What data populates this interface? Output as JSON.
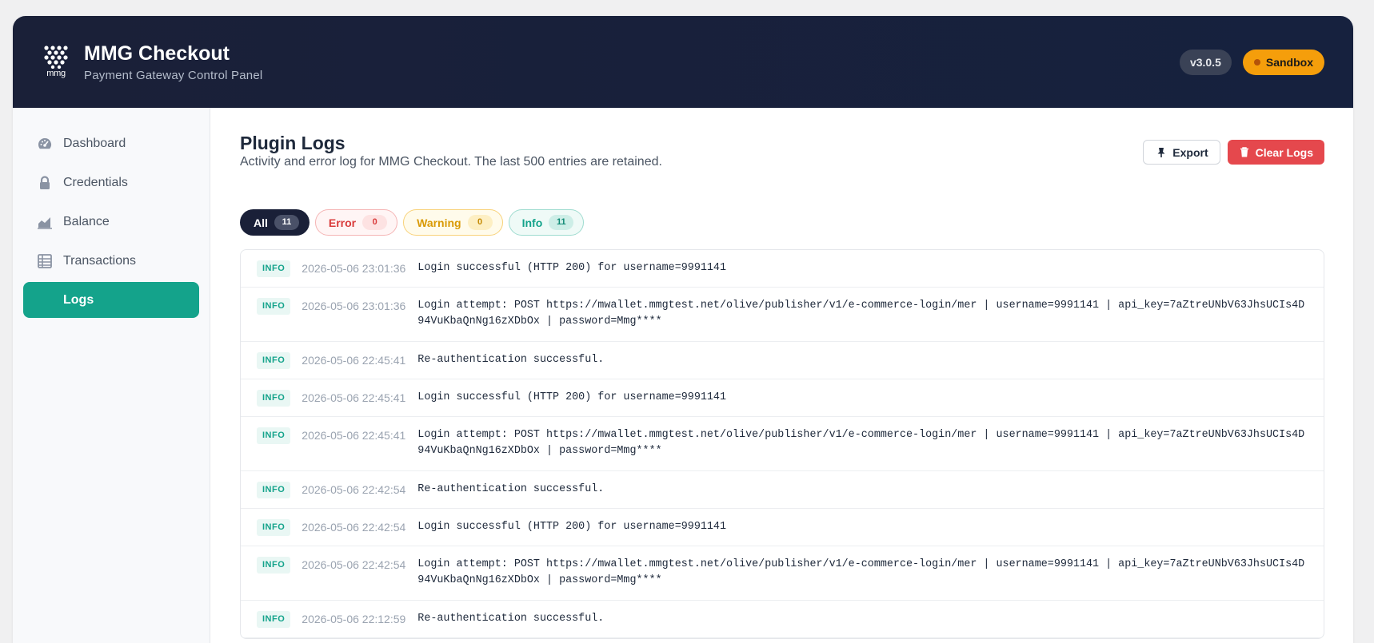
{
  "header": {
    "logo_text": "mmg",
    "title": "MMG Checkout",
    "subtitle": "Payment Gateway Control Panel",
    "version": "v3.0.5",
    "environment": "Sandbox"
  },
  "colors": {
    "header_bg": "#1a2038",
    "accent": "#14a38b",
    "danger": "#e5484d",
    "warning": "#f59e0b"
  },
  "sidebar": {
    "items": [
      {
        "label": "Dashboard",
        "icon": "gauge-icon",
        "active": false
      },
      {
        "label": "Credentials",
        "icon": "lock-icon",
        "active": false
      },
      {
        "label": "Balance",
        "icon": "chart-icon",
        "active": false
      },
      {
        "label": "Transactions",
        "icon": "list-icon",
        "active": false
      },
      {
        "label": "Logs",
        "icon": "",
        "active": true
      }
    ]
  },
  "main": {
    "title": "Plugin Logs",
    "description": "Activity and error log for MMG Checkout. The last 500 entries are retained.",
    "export_label": "Export",
    "clear_label": "Clear Logs",
    "filters": [
      {
        "label": "All",
        "count": "11"
      },
      {
        "label": "Error",
        "count": "0"
      },
      {
        "label": "Warning",
        "count": "0"
      },
      {
        "label": "Info",
        "count": "11"
      }
    ],
    "logs": [
      {
        "level": "INFO",
        "time": "2026-05-06 23:01:36",
        "message": "Login successful (HTTP 200) for username=9991141"
      },
      {
        "level": "INFO",
        "time": "2026-05-06 23:01:36",
        "message": "Login attempt: POST https://mwallet.mmgtest.net/olive/publisher/v1/e-commerce-login/mer | username=9991141 | api_key=7aZtreUNbV63JhsUCIs4D94VuKbaQnNg16zXDbOx | password=Mmg****"
      },
      {
        "level": "INFO",
        "time": "2026-05-06 22:45:41",
        "message": "Re-authentication successful."
      },
      {
        "level": "INFO",
        "time": "2026-05-06 22:45:41",
        "message": "Login successful (HTTP 200) for username=9991141"
      },
      {
        "level": "INFO",
        "time": "2026-05-06 22:45:41",
        "message": "Login attempt: POST https://mwallet.mmgtest.net/olive/publisher/v1/e-commerce-login/mer | username=9991141 | api_key=7aZtreUNbV63JhsUCIs4D94VuKbaQnNg16zXDbOx | password=Mmg****"
      },
      {
        "level": "INFO",
        "time": "2026-05-06 22:42:54",
        "message": "Re-authentication successful."
      },
      {
        "level": "INFO",
        "time": "2026-05-06 22:42:54",
        "message": "Login successful (HTTP 200) for username=9991141"
      },
      {
        "level": "INFO",
        "time": "2026-05-06 22:42:54",
        "message": "Login attempt: POST https://mwallet.mmgtest.net/olive/publisher/v1/e-commerce-login/mer | username=9991141 | api_key=7aZtreUNbV63JhsUCIs4D94VuKbaQnNg16zXDbOx | password=Mmg****"
      },
      {
        "level": "INFO",
        "time": "2026-05-06 22:12:59",
        "message": "Re-authentication successful."
      }
    ]
  }
}
